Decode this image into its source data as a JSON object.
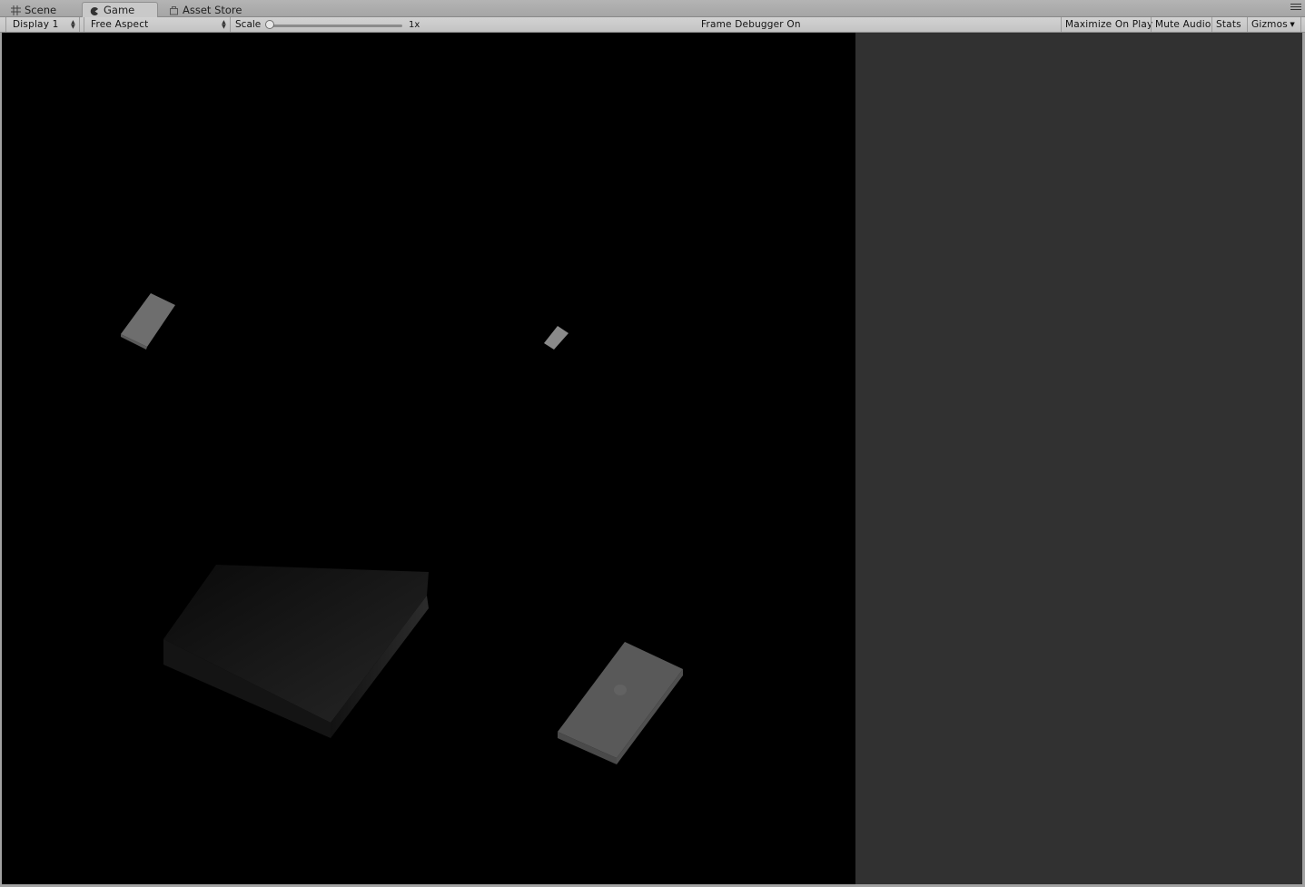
{
  "tabs": [
    {
      "label": "Scene",
      "icon": "scene-grid-icon"
    },
    {
      "label": "Game",
      "icon": "game-pacman-icon",
      "active": true
    },
    {
      "label": "Asset Store",
      "icon": "asset-store-icon"
    }
  ],
  "toolbar": {
    "display": "Display 1",
    "aspect": "Free Aspect",
    "scale_label": "Scale",
    "scale_value": "1x",
    "scale_slider_level": 0,
    "status": "Frame Debugger On",
    "maximize_on_play": "Maximize On Play",
    "mute_audio": "Mute Audio",
    "stats": "Stats",
    "gizmos": "Gizmos"
  },
  "colors": {
    "game_background": "#000000",
    "unused_area": "#313131",
    "toolbar": "#c8c8c8",
    "object_light": "#8c8c8c",
    "object_dark": "#1e1e1e"
  }
}
